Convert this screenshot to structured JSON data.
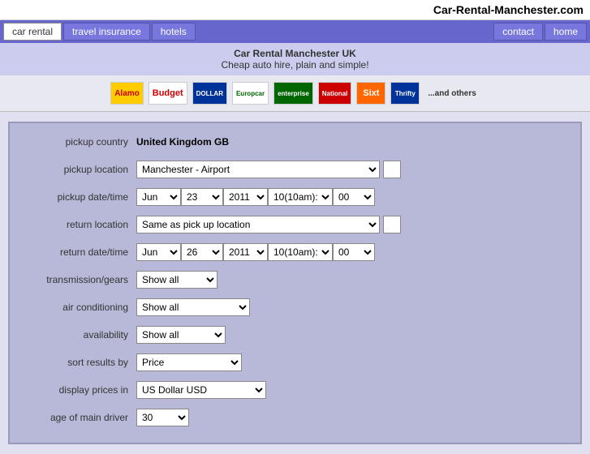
{
  "header": {
    "site_title": "Car-Rental-Manchester.com"
  },
  "nav": {
    "left_items": [
      "car rental",
      "travel insurance",
      "hotels"
    ],
    "right_items": [
      "contact",
      "home"
    ],
    "active": "car rental"
  },
  "tagline": {
    "line1": "Car Rental Manchester UK",
    "line2": "Cheap auto hire, plain and simple!"
  },
  "logos": [
    "Alamo",
    "Budget",
    "Dollar",
    "Europcar",
    "enterprise",
    "National",
    "Sixt",
    "Thrifty",
    "...and others"
  ],
  "form": {
    "pickup_country_label": "pickup country",
    "pickup_country_value": "United Kingdom GB",
    "pickup_location_label": "pickup location",
    "pickup_location_value": "Manchester - Airport",
    "pickup_datetime_label": "pickup date/time",
    "return_location_label": "return location",
    "return_location_value": "Same as pick up location",
    "return_datetime_label": "return date/time",
    "transmission_label": "transmission/gears",
    "transmission_value": "Show all",
    "aircon_label": "air conditioning",
    "aircon_value": "Show all",
    "availability_label": "availability",
    "availability_value": "Show all",
    "sort_label": "sort results by",
    "sort_value": "Price",
    "currency_label": "display prices in",
    "currency_value": "US Dollar USD",
    "age_label": "age of main driver",
    "age_value": "30",
    "pickup_month": "Jun",
    "pickup_day": "23",
    "pickup_year": "2011",
    "pickup_hour": "10(10am):",
    "pickup_min": "00",
    "return_month": "Jun",
    "return_day": "26",
    "return_year": "2011",
    "return_hour": "10(10am):",
    "return_min": "00"
  }
}
